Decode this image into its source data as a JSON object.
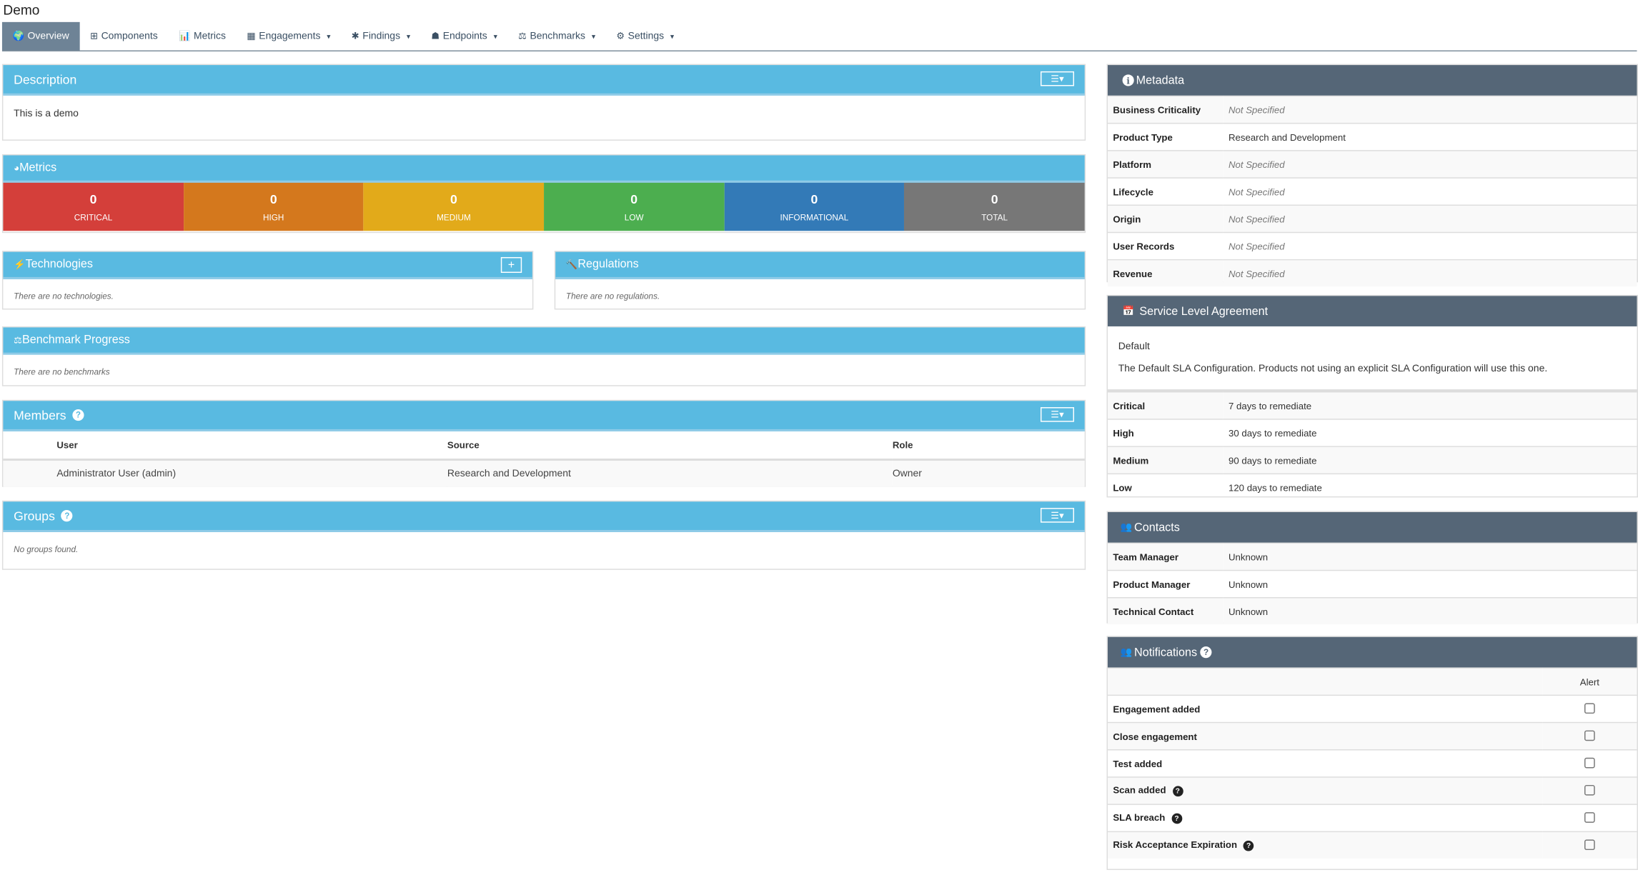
{
  "app": {
    "title": "Demo"
  },
  "nav": {
    "items": [
      {
        "label": "Overview",
        "icon": "globe-icon",
        "glyph": "🌍",
        "active": true,
        "dropdown": false
      },
      {
        "label": "Components",
        "icon": "table-icon",
        "glyph": "⊞",
        "dropdown": false
      },
      {
        "label": "Metrics",
        "icon": "bar-chart-icon",
        "glyph": "📊",
        "dropdown": false
      },
      {
        "label": "Engagements",
        "icon": "calendar-icon",
        "glyph": "▦",
        "dropdown": true
      },
      {
        "label": "Findings",
        "icon": "bug-icon",
        "glyph": "✱",
        "dropdown": true
      },
      {
        "label": "Endpoints",
        "icon": "sitemap-icon",
        "glyph": "☗",
        "dropdown": true
      },
      {
        "label": "Benchmarks",
        "icon": "balance-scale-icon",
        "glyph": "⚖",
        "dropdown": true
      },
      {
        "label": "Settings",
        "icon": "cogs-icon",
        "glyph": "⚙",
        "dropdown": true
      }
    ],
    "caret": "▾"
  },
  "description": {
    "title": "Description",
    "text": "This is a demo",
    "menu_glyph": "☰▾"
  },
  "metrics": {
    "title": "Metrics",
    "icon_glyph": "◕",
    "items": [
      {
        "value": "0",
        "label": "CRITICAL",
        "color": "#d43f3a"
      },
      {
        "value": "0",
        "label": "HIGH",
        "color": "#d4781d"
      },
      {
        "value": "0",
        "label": "MEDIUM",
        "color": "#e2aa1a"
      },
      {
        "value": "0",
        "label": "LOW",
        "color": "#4cae4f"
      },
      {
        "value": "0",
        "label": "INFORMATIONAL",
        "color": "#337ab7"
      },
      {
        "value": "0",
        "label": "TOTAL",
        "color": "#777777"
      }
    ]
  },
  "technologies": {
    "title": "Technologies",
    "icon_glyph": "⚡",
    "empty": "There are no technologies.",
    "add_glyph": "+"
  },
  "regulations": {
    "title": "Regulations",
    "icon_glyph": "🔨",
    "empty": "There are no regulations."
  },
  "benchmark": {
    "title": "Benchmark Progress",
    "icon_glyph": "⚖",
    "empty": "There are no benchmarks"
  },
  "members": {
    "title": "Members",
    "help_glyph": "?",
    "columns": [
      "User",
      "Source",
      "Role"
    ],
    "rows": [
      {
        "user": "Administrator User (admin)",
        "source": "Research and Development",
        "role": "Owner"
      }
    ]
  },
  "groups": {
    "title": "Groups",
    "help_glyph": "?",
    "empty": "No groups found."
  },
  "metadata": {
    "title": "Metadata",
    "icon_glyph": "i",
    "rows": [
      {
        "key": "Business Criticality",
        "value": "Not Specified",
        "unset": true
      },
      {
        "key": "Product Type",
        "value": "Research and Development",
        "unset": false
      },
      {
        "key": "Platform",
        "value": "Not Specified",
        "unset": true
      },
      {
        "key": "Lifecycle",
        "value": "Not Specified",
        "unset": true
      },
      {
        "key": "Origin",
        "value": "Not Specified",
        "unset": true
      },
      {
        "key": "User Records",
        "value": "Not Specified",
        "unset": true
      },
      {
        "key": "Revenue",
        "value": "Not Specified",
        "unset": true
      }
    ]
  },
  "sla": {
    "title": "Service Level Agreement",
    "icon_glyph": "📅",
    "name": "Default",
    "description": "The Default SLA Configuration. Products not using an explicit SLA Configuration will use this one.",
    "rows": [
      {
        "key": "Critical",
        "value": "7 days to remediate"
      },
      {
        "key": "High",
        "value": "30 days to remediate"
      },
      {
        "key": "Medium",
        "value": "90 days to remediate"
      },
      {
        "key": "Low",
        "value": "120 days to remediate"
      }
    ]
  },
  "contacts": {
    "title": "Contacts",
    "icon_glyph": "👥",
    "rows": [
      {
        "key": "Team Manager",
        "value": "Unknown"
      },
      {
        "key": "Product Manager",
        "value": "Unknown"
      },
      {
        "key": "Technical Contact",
        "value": "Unknown"
      }
    ]
  },
  "notifications": {
    "title": "Notifications",
    "icon_glyph": "👥",
    "help_glyph": "?",
    "column": "Alert",
    "rows": [
      {
        "label": "Engagement added",
        "help": false,
        "checked": false
      },
      {
        "label": "Close engagement",
        "help": false,
        "checked": false
      },
      {
        "label": "Test added",
        "help": false,
        "checked": false
      },
      {
        "label": "Scan added",
        "help": true,
        "checked": false
      },
      {
        "label": "SLA breach",
        "help": true,
        "checked": false
      },
      {
        "label": "Risk Acceptance Expiration",
        "help": true,
        "checked": false
      }
    ]
  }
}
